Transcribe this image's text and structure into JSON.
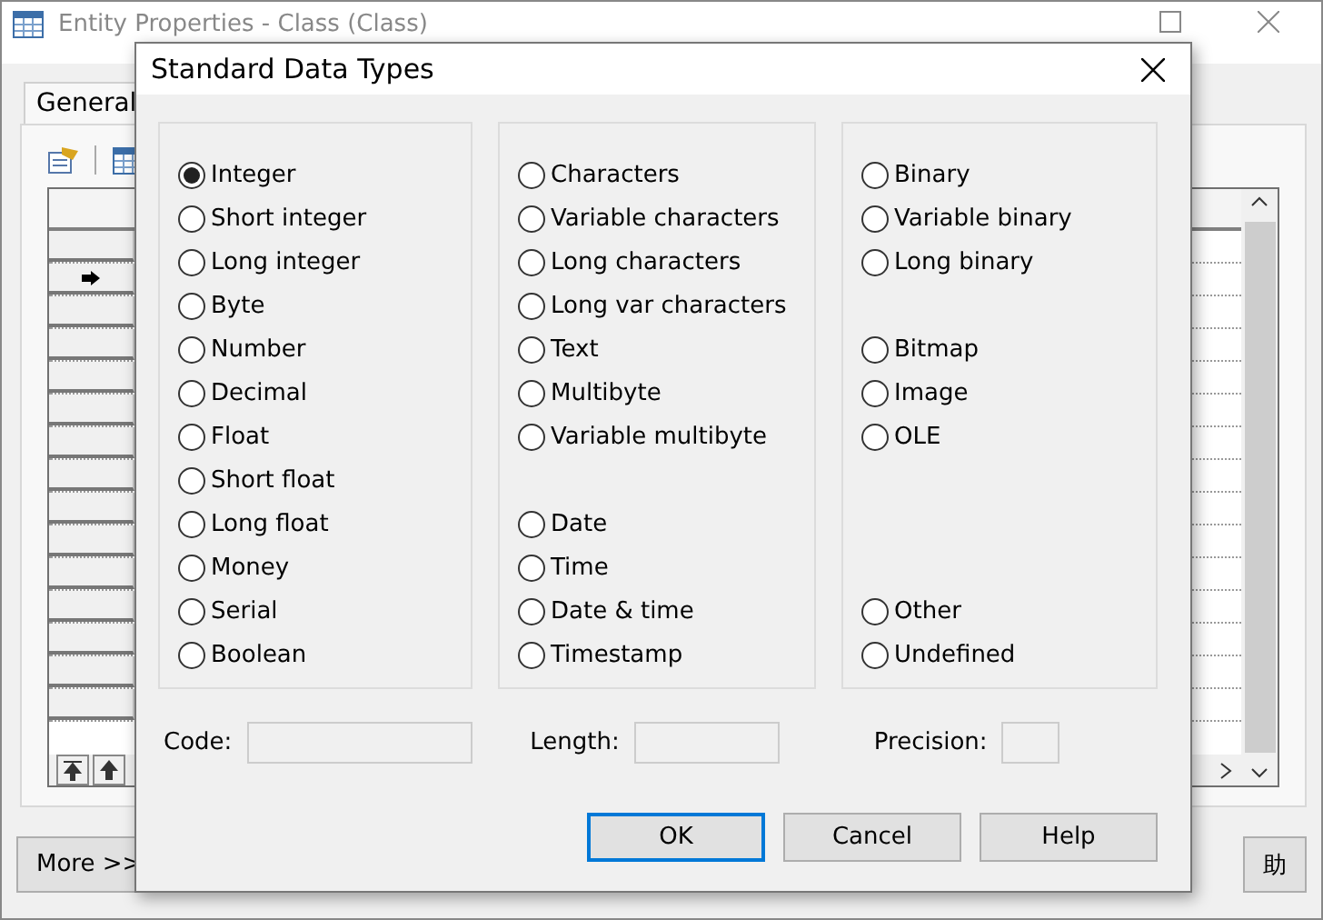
{
  "window": {
    "title": "Entity Properties - Class (Class)"
  },
  "tabs": [
    {
      "label": "General",
      "selected": true
    }
  ],
  "grid": {
    "rows": [
      {
        "current": false
      },
      {
        "current": true
      },
      {
        "current": false
      },
      {
        "current": false
      },
      {
        "current": false
      },
      {
        "current": false
      },
      {
        "current": false
      },
      {
        "current": false
      },
      {
        "current": false
      },
      {
        "current": false
      },
      {
        "current": false
      },
      {
        "current": false
      },
      {
        "current": false
      },
      {
        "current": false
      },
      {
        "current": false
      }
    ]
  },
  "buttons": [
    {
      "label": "More >>"
    },
    {
      "label": "助"
    }
  ],
  "dialog": {
    "title": "Standard Data Types",
    "columns": [
      [
        {
          "kind": "radio",
          "label": "Integer",
          "selected": true
        },
        {
          "kind": "radio",
          "label": "Short integer",
          "selected": false
        },
        {
          "kind": "radio",
          "label": "Long integer",
          "selected": false
        },
        {
          "kind": "radio",
          "label": "Byte",
          "selected": false
        },
        {
          "kind": "radio",
          "label": "Number",
          "selected": false
        },
        {
          "kind": "radio",
          "label": "Decimal",
          "selected": false
        },
        {
          "kind": "radio",
          "label": "Float",
          "selected": false
        },
        {
          "kind": "radio",
          "label": "Short float",
          "selected": false
        },
        {
          "kind": "radio",
          "label": "Long float",
          "selected": false
        },
        {
          "kind": "radio",
          "label": "Money",
          "selected": false
        },
        {
          "kind": "radio",
          "label": "Serial",
          "selected": false
        },
        {
          "kind": "radio",
          "label": "Boolean",
          "selected": false
        }
      ],
      [
        {
          "kind": "radio",
          "label": "Characters",
          "selected": false
        },
        {
          "kind": "radio",
          "label": "Variable characters",
          "selected": false
        },
        {
          "kind": "radio",
          "label": "Long characters",
          "selected": false
        },
        {
          "kind": "radio",
          "label": "Long var characters",
          "selected": false
        },
        {
          "kind": "radio",
          "label": "Text",
          "selected": false
        },
        {
          "kind": "radio",
          "label": "Multibyte",
          "selected": false
        },
        {
          "kind": "radio",
          "label": "Variable multibyte",
          "selected": false
        },
        {
          "kind": "spacer"
        },
        {
          "kind": "radio",
          "label": "Date",
          "selected": false
        },
        {
          "kind": "radio",
          "label": "Time",
          "selected": false
        },
        {
          "kind": "radio",
          "label": "Date & time",
          "selected": false
        },
        {
          "kind": "radio",
          "label": "Timestamp",
          "selected": false
        }
      ],
      [
        {
          "kind": "radio",
          "label": "Binary",
          "selected": false
        },
        {
          "kind": "radio",
          "label": "Variable binary",
          "selected": false
        },
        {
          "kind": "radio",
          "label": "Long binary",
          "selected": false
        },
        {
          "kind": "spacer"
        },
        {
          "kind": "radio",
          "label": "Bitmap",
          "selected": false
        },
        {
          "kind": "radio",
          "label": "Image",
          "selected": false
        },
        {
          "kind": "radio",
          "label": "OLE",
          "selected": false
        },
        {
          "kind": "spacer"
        },
        {
          "kind": "spacer"
        },
        {
          "kind": "spacer"
        },
        {
          "kind": "radio",
          "label": "Other",
          "selected": false
        },
        {
          "kind": "radio",
          "label": "Undefined",
          "selected": false
        }
      ]
    ],
    "fields": [
      {
        "label": "Code:"
      },
      {
        "label": "Length:"
      },
      {
        "label": "Precision:"
      }
    ],
    "buttons": [
      {
        "label": "OK",
        "default": true
      },
      {
        "label": "Cancel",
        "default": false
      },
      {
        "label": "Help",
        "default": false
      }
    ]
  }
}
